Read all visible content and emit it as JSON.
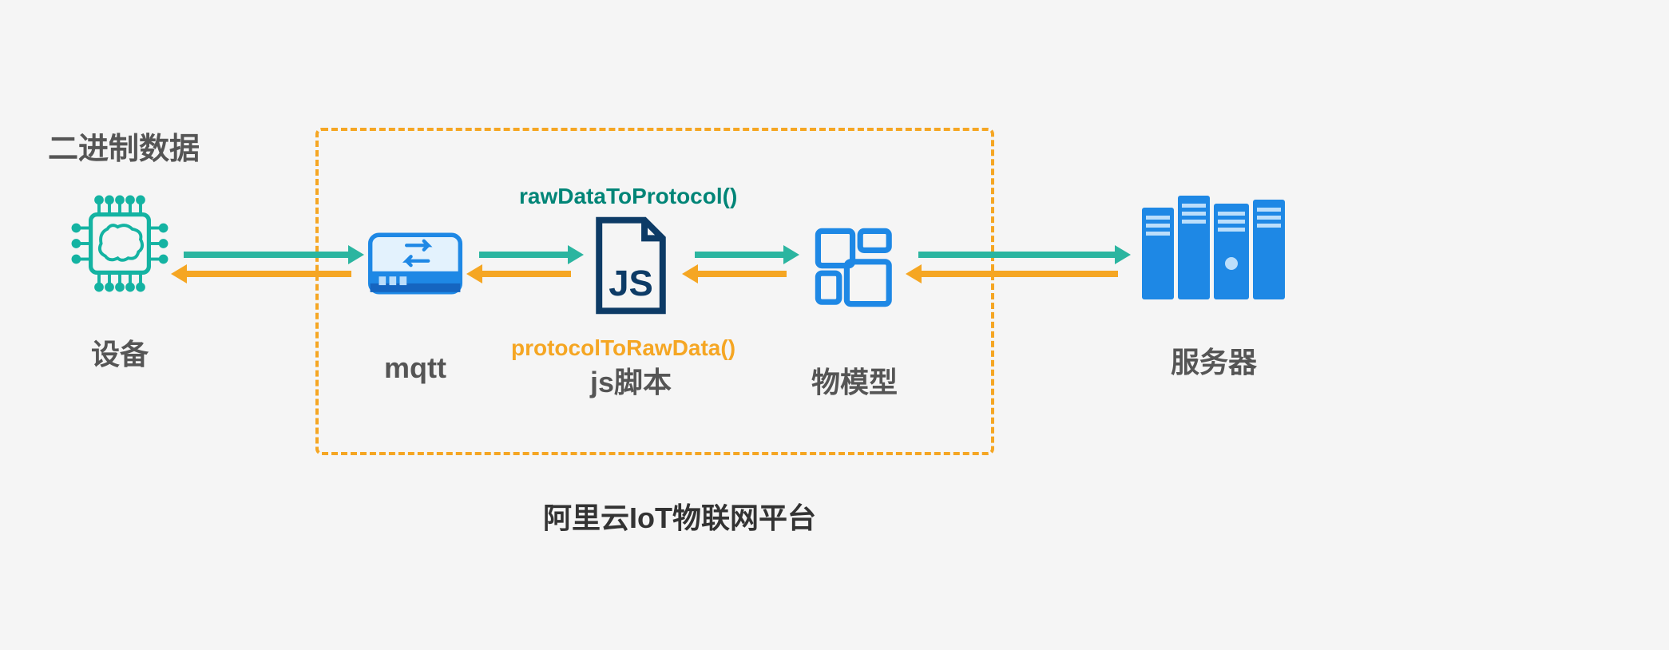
{
  "title_binary": "二进制数据",
  "platform_caption": "阿里云IoT物联网平台",
  "nodes": {
    "device": {
      "label": "设备"
    },
    "mqtt": {
      "label": "mqtt"
    },
    "js": {
      "label": "js脚本"
    },
    "model": {
      "label": "物模型"
    },
    "server": {
      "label": "服务器"
    }
  },
  "functions": {
    "to_protocol": "rawDataToProtocol()",
    "to_raw": "protocolToRawData()"
  },
  "colors": {
    "arrow_forward": "#2bb5a0",
    "arrow_back": "#f5a623",
    "box_border": "#f5a623",
    "icon_blue": "#1e88e5",
    "icon_teal": "#14b3a2",
    "js_navy": "#0d3b66"
  }
}
